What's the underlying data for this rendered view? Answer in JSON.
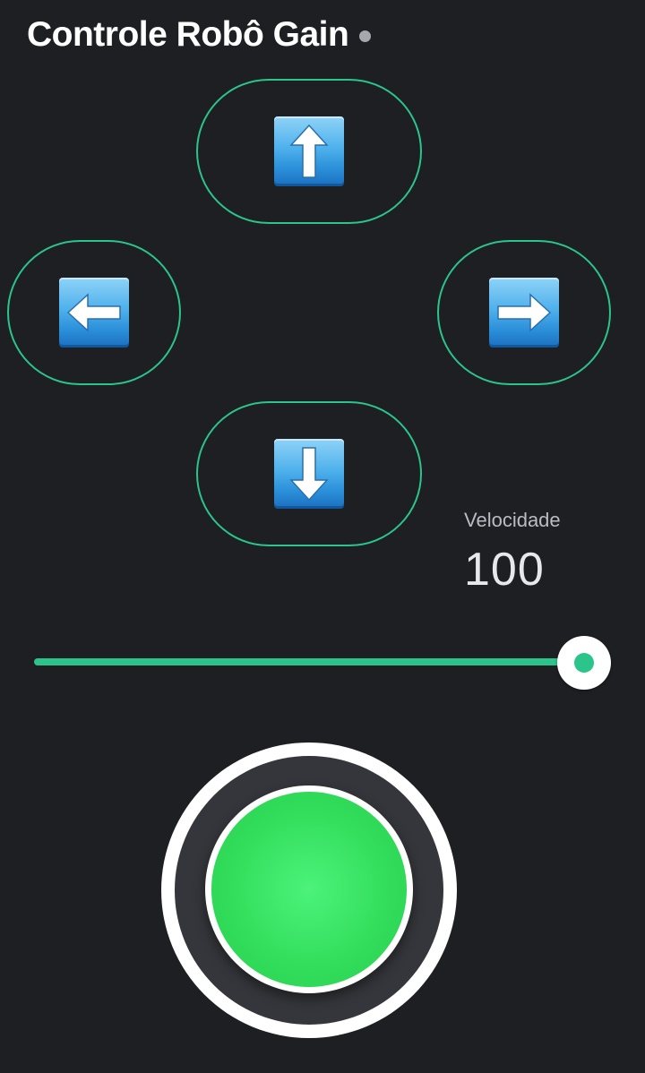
{
  "header": {
    "title": "Controle Robô Gain",
    "status_color": "#a6a8ad"
  },
  "controls": {
    "up": {
      "icon": "arrow-up-icon"
    },
    "down": {
      "icon": "arrow-down-icon"
    },
    "left": {
      "icon": "arrow-left-icon"
    },
    "right": {
      "icon": "arrow-right-icon"
    }
  },
  "speed": {
    "label": "Velocidade",
    "value": "100",
    "fraction": 1.0
  },
  "colors": {
    "accent": "#2bc48a",
    "background": "#1e1f23",
    "joystick": "#33de5c"
  }
}
